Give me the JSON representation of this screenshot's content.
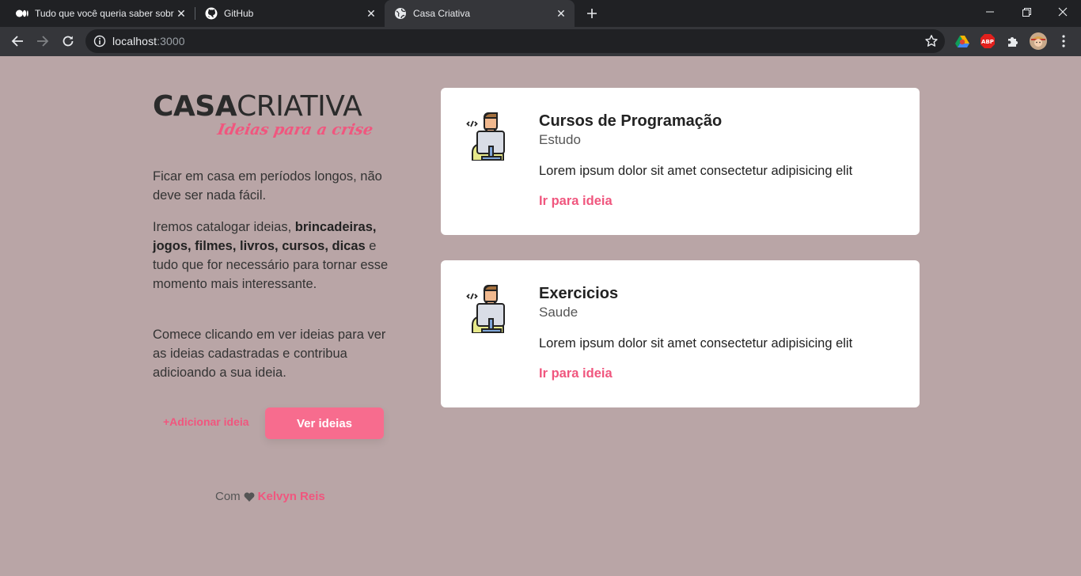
{
  "browser": {
    "tabs": [
      {
        "title": "Tudo que você queria saber sobre",
        "icon": "medium-icon"
      },
      {
        "title": "GitHub",
        "icon": "github-icon"
      },
      {
        "title": "Casa Criativa",
        "icon": "globe-icon"
      }
    ],
    "url_host": "localhost",
    "url_port": ":3000"
  },
  "logo": {
    "bold": "CASA",
    "light": "CRIATIVA",
    "tagline": "Ideias para a crise"
  },
  "intro": {
    "p1": "Ficar em casa em períodos longos, não deve ser nada fácil.",
    "p2_pre": "Iremos catalogar ideias, ",
    "p2_bold": "brincadeiras, jogos, filmes, livros, cursos, dicas",
    "p2_post": " e tudo que for necessário para tornar esse momento mais interessante.",
    "p3": "Comece clicando em ver ideias para ver as ideias cadastradas e contribua adicioando a sua ideia."
  },
  "actions": {
    "add_label": "+Adicionar ideia",
    "view_label": "Ver ideias"
  },
  "footer": {
    "prefix": "Com",
    "author": "Kelvyn Reis"
  },
  "ideas": [
    {
      "title": "Cursos de Programação",
      "category": "Estudo",
      "description": "Lorem ipsum dolor sit amet consectetur adipisicing elit",
      "link": "Ir para ideia",
      "icon": "programmer-icon"
    },
    {
      "title": "Exercicios",
      "category": "Saude",
      "description": "Lorem ipsum dolor sit amet consectetur adipisicing elit",
      "link": "Ir para ideia",
      "icon": "programmer-icon"
    }
  ],
  "colors": {
    "background": "#b9a5a6",
    "accent": "#f0567e",
    "button": "#f76c8e"
  }
}
